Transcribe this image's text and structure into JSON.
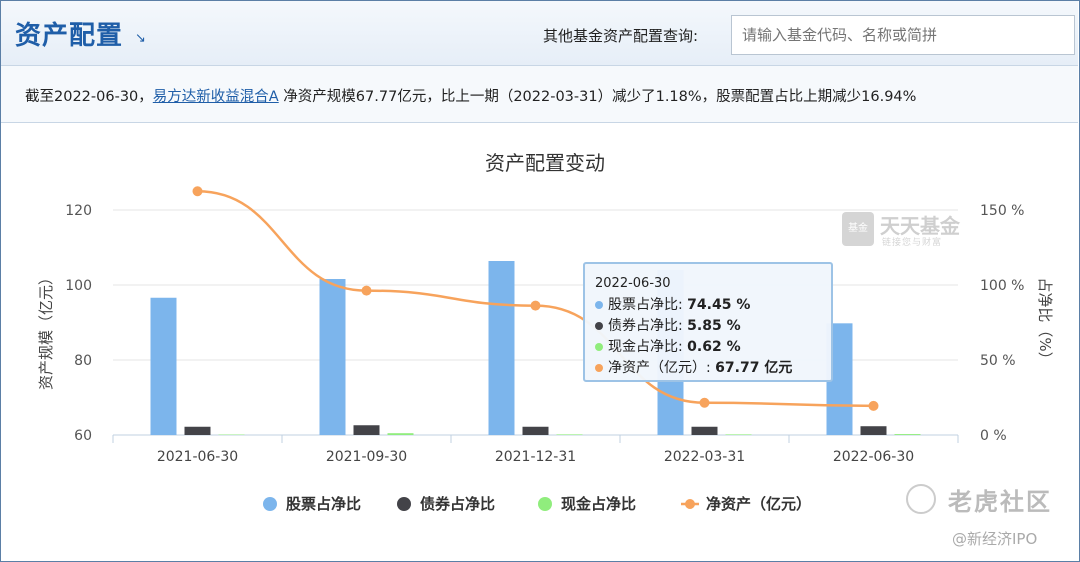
{
  "header": {
    "title": "资产配置",
    "query_label": "其他基金资产配置查询:",
    "query_placeholder": "请输入基金代码、名称或简拼"
  },
  "summary": {
    "prefix": "截至2022-06-30，",
    "fund_link": "易方达新收益混合A",
    "suffix": " 净资产规模67.77亿元，比上一期（2022-03-31）减少了1.18%，股票配置占比上期减少16.94%"
  },
  "chart_data": {
    "type": "bar",
    "title": "资产配置变动",
    "categories": [
      "2021-06-30",
      "2021-09-30",
      "2021-12-31",
      "2022-03-31",
      "2022-06-30"
    ],
    "ylabel_left": "资产规模（亿元）",
    "ylabel_right": "占净比（%）",
    "ylim_left": [
      60,
      120
    ],
    "yticks_left": [
      "60",
      "80",
      "100",
      "120"
    ],
    "ylim_right": [
      0,
      150
    ],
    "yticks_right": [
      "0 %",
      "50 %",
      "100 %",
      "150 %"
    ],
    "series": [
      {
        "name": "股票占净比",
        "type": "bar",
        "axis": "right",
        "color": "#7cb5ec",
        "values": [
          91.5,
          104,
          116,
          110,
          74.45
        ]
      },
      {
        "name": "债券占净比",
        "type": "bar",
        "axis": "right",
        "color": "#434348",
        "values": [
          5.5,
          6.5,
          5.5,
          5.5,
          5.85
        ]
      },
      {
        "name": "现金占净比",
        "type": "bar",
        "axis": "right",
        "color": "#90ed7d",
        "values": [
          0.3,
          1.2,
          0.4,
          0.4,
          0.62
        ]
      },
      {
        "name": "净资产（亿元）",
        "type": "line",
        "axis": "left",
        "color": "#f7a35c",
        "values": [
          125,
          98.5,
          94.5,
          68.6,
          67.77
        ]
      }
    ],
    "legend_position": "bottom",
    "grid": true
  },
  "tooltip": {
    "date": "2022-06-30",
    "rows": [
      {
        "label": "股票占净比:",
        "value": "74.45 %",
        "color": "#7cb5ec"
      },
      {
        "label": "债券占净比:",
        "value": "5.85 %",
        "color": "#434348"
      },
      {
        "label": "现金占净比:",
        "value": "0.62 %",
        "color": "#90ed7d"
      },
      {
        "label": "净资产（亿元）:",
        "value": "67.77 亿元",
        "color": "#f7a35c"
      }
    ]
  },
  "watermarks": {
    "fund_logo_name": "天天基金",
    "fund_logo_box": "基金",
    "fund_logo_slogan": "链接您与财富",
    "tiger": "老虎社区",
    "wechat": "@新经济IPO"
  }
}
